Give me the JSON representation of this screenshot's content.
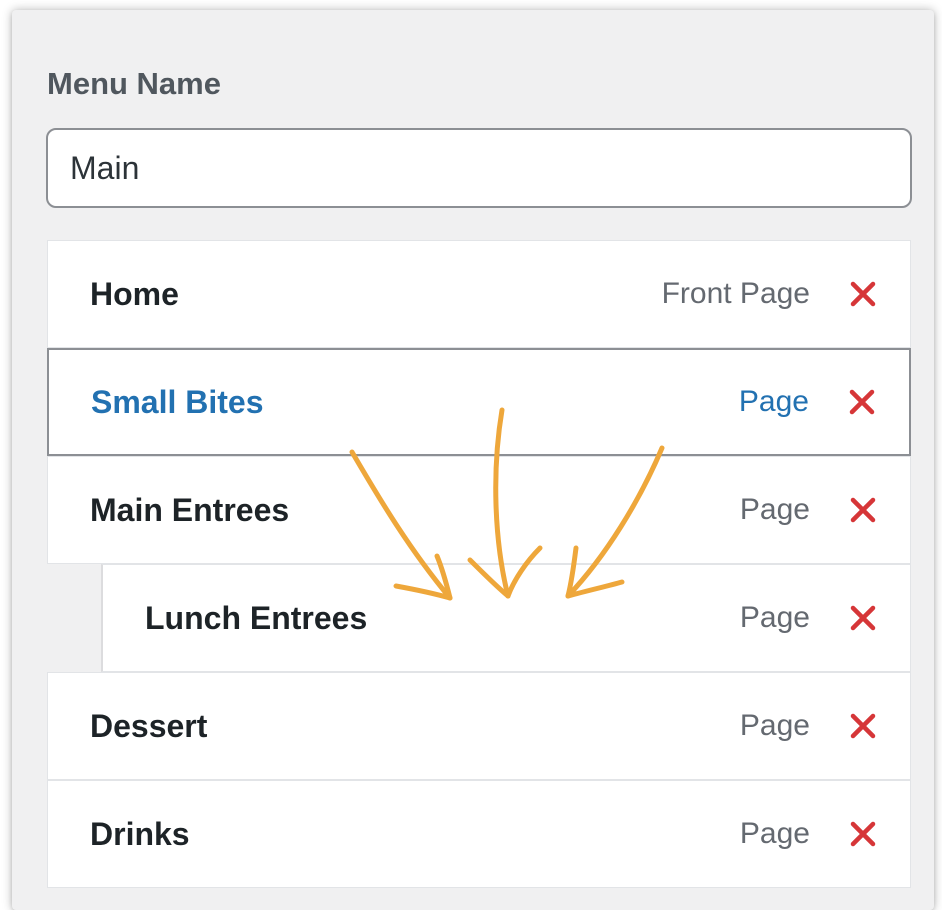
{
  "menu_name": {
    "label": "Menu Name",
    "value": "Main"
  },
  "items": [
    {
      "title": "Home",
      "type": "Front Page",
      "depth": 0,
      "active": false
    },
    {
      "title": "Small Bites",
      "type": "Page",
      "depth": 0,
      "active": true
    },
    {
      "title": "Main Entrees",
      "type": "Page",
      "depth": 0,
      "active": false
    },
    {
      "title": "Lunch Entrees",
      "type": "Page",
      "depth": 1,
      "active": false
    },
    {
      "title": "Dessert",
      "type": "Page",
      "depth": 0,
      "active": false
    },
    {
      "title": "Drinks",
      "type": "Page",
      "depth": 0,
      "active": false
    }
  ],
  "colors": {
    "active_text": "#2271b1",
    "remove_icon": "#d63638",
    "arrow_annotation": "#eea73b",
    "panel_background": "#f0f0f1"
  },
  "icons": {
    "remove": "close-icon",
    "annotation": "curved-arrow-icon"
  }
}
